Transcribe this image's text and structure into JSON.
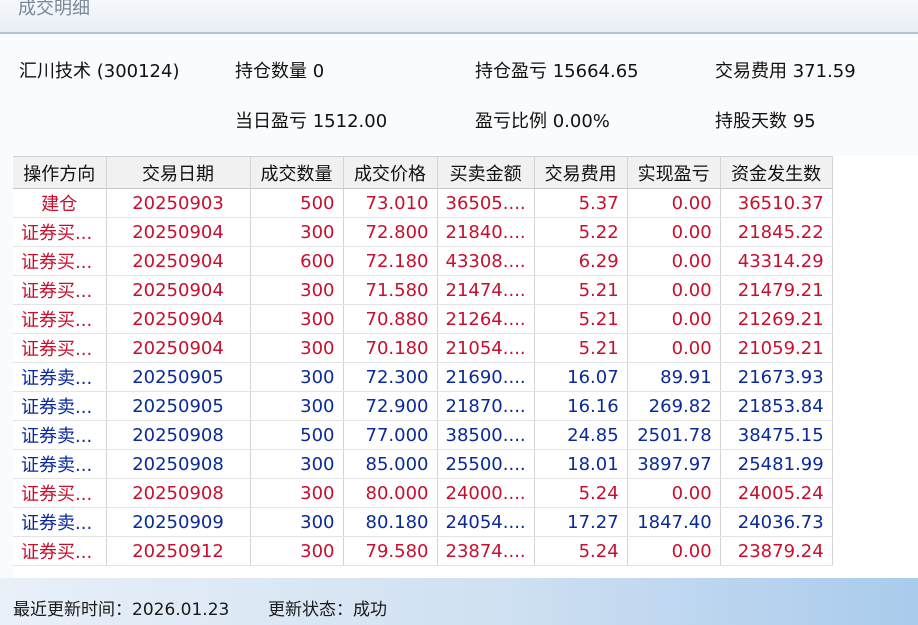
{
  "window": {
    "title": "成交明细"
  },
  "summary": {
    "stock": "汇川技术 (300124)",
    "position_qty": "持仓数量 0",
    "position_pnl": "持仓盈亏 15664.65",
    "trade_fee": "交易费用 371.59",
    "daily_pnl": "当日盈亏 1512.00",
    "pnl_ratio": "盈亏比例 0.00%",
    "hold_days": "持股天数 95"
  },
  "table": {
    "columns": [
      "操作方向",
      "交易日期",
      "成交数量",
      "成交价格",
      "买卖金额",
      "交易费用",
      "实现盈亏",
      "资金发生数"
    ],
    "rows": [
      {
        "side": "buy",
        "open": true,
        "cells": [
          "建仓",
          "20250903",
          "500",
          "73.010",
          "36505....",
          "5.37",
          "0.00",
          "36510.37"
        ]
      },
      {
        "side": "buy",
        "cells": [
          "证券买...",
          "20250904",
          "300",
          "72.800",
          "21840....",
          "5.22",
          "0.00",
          "21845.22"
        ]
      },
      {
        "side": "buy",
        "cells": [
          "证券买...",
          "20250904",
          "600",
          "72.180",
          "43308....",
          "6.29",
          "0.00",
          "43314.29"
        ]
      },
      {
        "side": "buy",
        "cells": [
          "证券买...",
          "20250904",
          "300",
          "71.580",
          "21474....",
          "5.21",
          "0.00",
          "21479.21"
        ]
      },
      {
        "side": "buy",
        "cells": [
          "证券买...",
          "20250904",
          "300",
          "70.880",
          "21264....",
          "5.21",
          "0.00",
          "21269.21"
        ]
      },
      {
        "side": "buy",
        "cells": [
          "证券买...",
          "20250904",
          "300",
          "70.180",
          "21054....",
          "5.21",
          "0.00",
          "21059.21"
        ]
      },
      {
        "side": "sell",
        "cells": [
          "证券卖...",
          "20250905",
          "300",
          "72.300",
          "21690....",
          "16.07",
          "89.91",
          "21673.93"
        ]
      },
      {
        "side": "sell",
        "cells": [
          "证券卖...",
          "20250905",
          "300",
          "72.900",
          "21870....",
          "16.16",
          "269.82",
          "21853.84"
        ]
      },
      {
        "side": "sell",
        "cells": [
          "证券卖...",
          "20250908",
          "500",
          "77.000",
          "38500....",
          "24.85",
          "2501.78",
          "38475.15"
        ]
      },
      {
        "side": "sell",
        "cells": [
          "证券卖...",
          "20250908",
          "300",
          "85.000",
          "25500....",
          "18.01",
          "3897.97",
          "25481.99"
        ]
      },
      {
        "side": "buy",
        "cells": [
          "证券买...",
          "20250908",
          "300",
          "80.000",
          "24000....",
          "5.24",
          "0.00",
          "24005.24"
        ]
      },
      {
        "side": "sell",
        "cells": [
          "证券卖...",
          "20250909",
          "300",
          "80.180",
          "24054....",
          "17.27",
          "1847.40",
          "24036.73"
        ]
      },
      {
        "side": "buy",
        "cells": [
          "证券买...",
          "20250912",
          "300",
          "79.580",
          "23874....",
          "5.24",
          "0.00",
          "23879.24"
        ]
      }
    ]
  },
  "status": {
    "update_time": "最近更新时间：2026.01.23",
    "update_state": "更新状态：成功"
  },
  "colors": {
    "buy": "#c8102e",
    "sell": "#0a2a9c"
  }
}
